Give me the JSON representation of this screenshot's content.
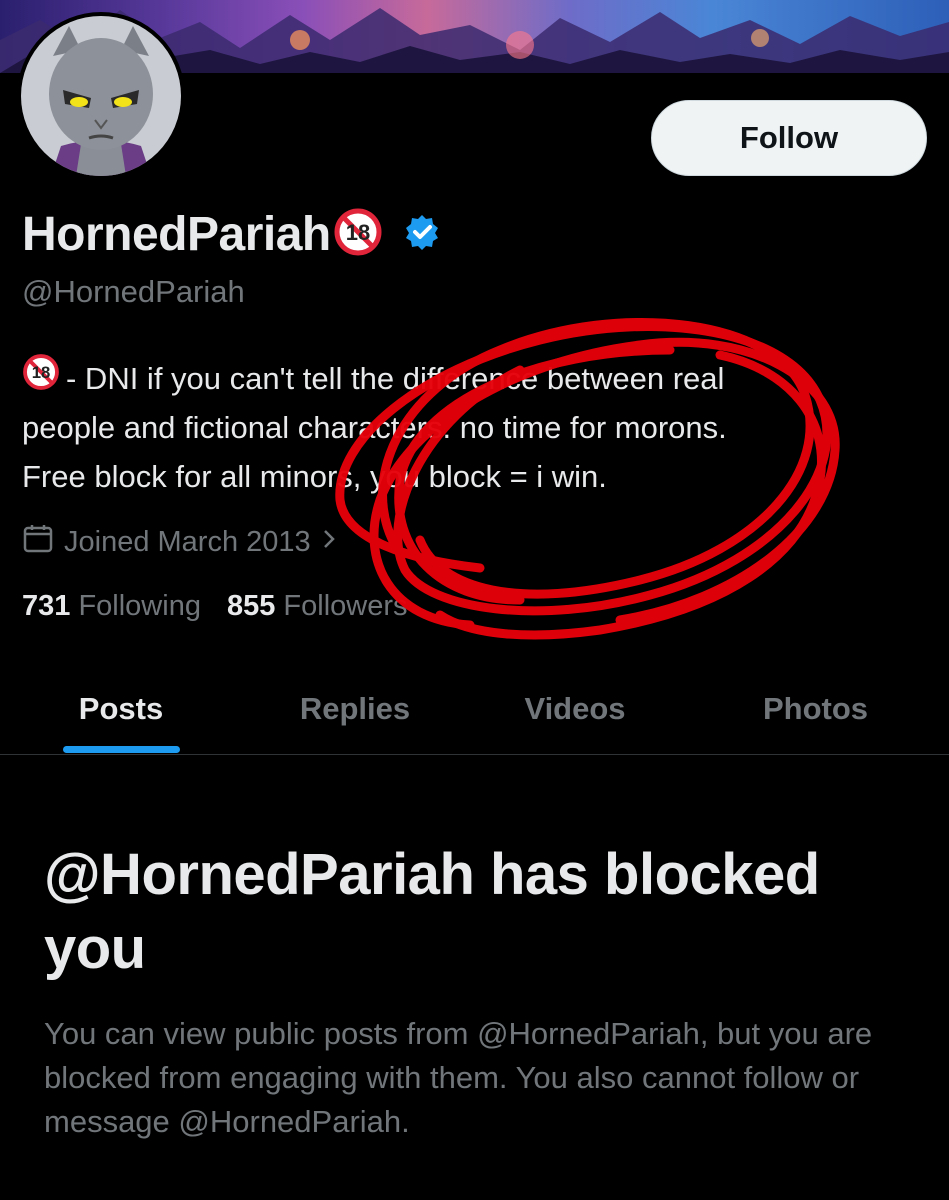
{
  "profile": {
    "display_name": "HornedPariah",
    "handle": "@HornedPariah",
    "verified": true,
    "adult_badge_icon": "18-plus-prohibited-icon",
    "bio_lines": [
      "- DNI if you can't tell the difference between real",
      "people and fictional characters. no time for morons.",
      "Free block for all minors, you block = i win."
    ],
    "joined": "Joined March 2013",
    "following_count": "731",
    "following_label": "Following",
    "followers_count": "855",
    "followers_label": "Followers"
  },
  "header": {
    "follow_label": "Follow"
  },
  "tabs": [
    {
      "label": "Posts",
      "active": true
    },
    {
      "label": "Replies",
      "active": false
    },
    {
      "label": "Videos",
      "active": false
    },
    {
      "label": "Photos",
      "active": false
    }
  ],
  "blocked_notice": {
    "title": "@HornedPariah has blocked you",
    "description": "You can view public posts from @HornedPariah, but you are blocked from engaging with them. You also cannot follow or message @HornedPariah."
  },
  "icons": {
    "verified": "verified-check-icon",
    "calendar": "calendar-icon",
    "chevron": "chevron-right-icon"
  },
  "colors": {
    "background": "#000000",
    "accent": "#1d9bf0",
    "muted": "#71767b",
    "annotation": "#e8000a"
  }
}
